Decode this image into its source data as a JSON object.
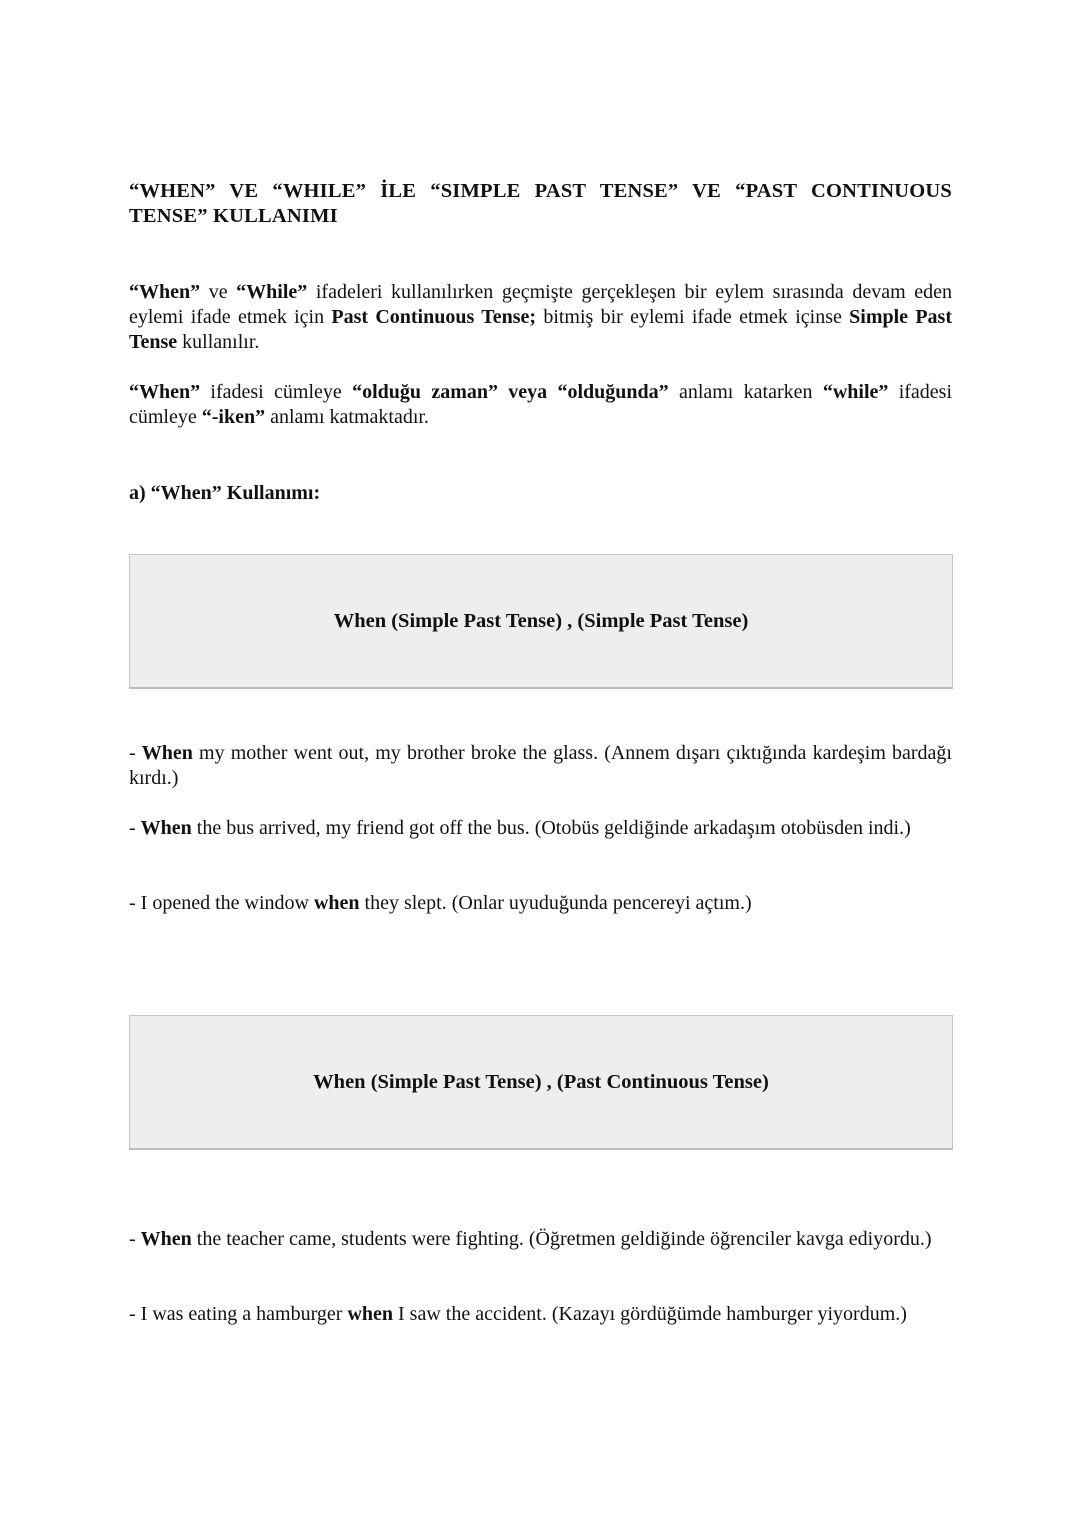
{
  "document": {
    "title": "“WHEN” VE “WHILE” İLE “SIMPLE PAST TENSE” VE “PAST CONTINUOUS TENSE” KULLANIMI",
    "intro_paragraphs": [
      {
        "segments": [
          {
            "text": "“When”",
            "bold": true
          },
          {
            "text": " ve ",
            "bold": false
          },
          {
            "text": "“While”",
            "bold": true
          },
          {
            "text": " ifadeleri kullanılırken geçmişte gerçekleşen bir eylem sırasında devam eden eylemi ifade etmek için ",
            "bold": false
          },
          {
            "text": "Past Continuous Tense;",
            "bold": true
          },
          {
            "text": " bitmiş bir eylemi ifade etmek içinse ",
            "bold": false
          },
          {
            "text": "Simple Past Tense",
            "bold": true
          },
          {
            "text": " kullanılır.",
            "bold": false
          }
        ]
      },
      {
        "segments": [
          {
            "text": "“When”",
            "bold": true
          },
          {
            "text": " ifadesi cümleye ",
            "bold": false
          },
          {
            "text": "“olduğu zaman” veya “olduğunda”",
            "bold": true
          },
          {
            "text": " anlamı katarken ",
            "bold": false
          },
          {
            "text": "“while”",
            "bold": true
          },
          {
            "text": " ifadesi cümleye ",
            "bold": false
          },
          {
            "text": "“-iken”",
            "bold": true
          },
          {
            "text": " anlamı katmaktadır.",
            "bold": false
          }
        ]
      }
    ],
    "section_a_heading": "a) “When” Kullanımı:",
    "formulas": [
      "When (Simple Past Tense) , (Simple Past Tense)",
      "When (Simple Past Tense) , (Past Continuous Tense)"
    ],
    "examples_group1": [
      {
        "segments": [
          {
            "text": "- ",
            "bold": false
          },
          {
            "text": "When",
            "bold": true
          },
          {
            "text": " my mother went out, my brother broke the glass. (Annem dışarı çıktığında kardeşim bardağı kırdı.)",
            "bold": false
          }
        ]
      },
      {
        "segments": [
          {
            "text": "- ",
            "bold": false
          },
          {
            "text": "When",
            "bold": true
          },
          {
            "text": " the bus arrived, my friend got off the bus. (Otobüs geldiğinde arkadaşım otobüsden indi.)",
            "bold": false
          }
        ]
      },
      {
        "segments": [
          {
            "text": "- I opened the window ",
            "bold": false
          },
          {
            "text": "when",
            "bold": true
          },
          {
            "text": " they slept. (Onlar uyuduğunda pencereyi açtım.)",
            "bold": false
          }
        ]
      }
    ],
    "examples_group2": [
      {
        "segments": [
          {
            "text": "- ",
            "bold": false
          },
          {
            "text": "When",
            "bold": true
          },
          {
            "text": " the teacher came, students were fighting. (Öğretmen geldiğinde öğrenciler kavga ediyordu.)",
            "bold": false
          }
        ]
      },
      {
        "segments": [
          {
            "text": "- I was eating a hamburger ",
            "bold": false
          },
          {
            "text": "when",
            "bold": true
          },
          {
            "text": " I saw the accident. (Kazayı gördüğümde hamburger yiyordum.)",
            "bold": false
          }
        ]
      }
    ],
    "colors": {
      "text": "#111111",
      "box_background": "#eeeeee",
      "box_border": "#c4c4c4"
    }
  }
}
